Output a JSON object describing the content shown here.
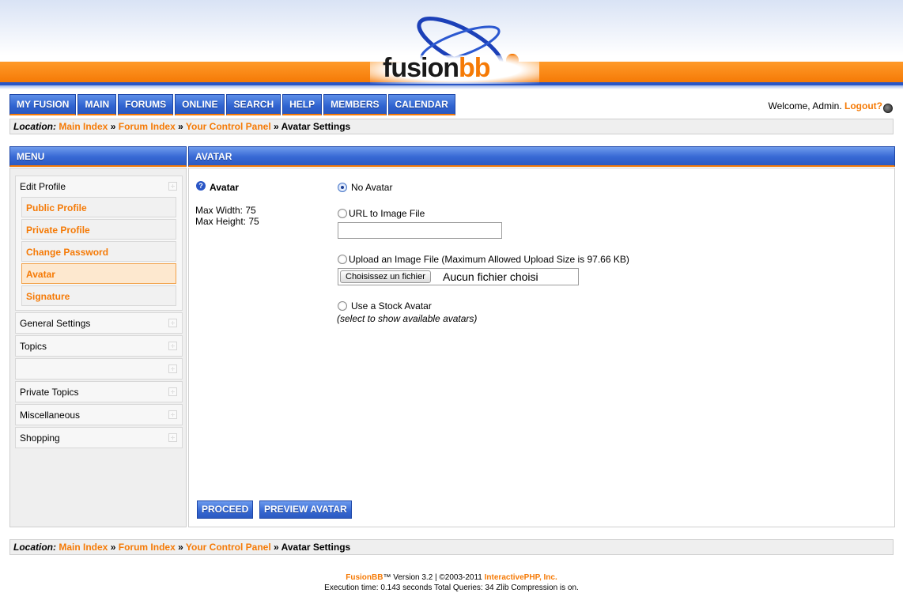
{
  "header": {
    "logo_fusion": "fusion",
    "logo_bb": "bb"
  },
  "nav": {
    "items": [
      {
        "label": "MY FUSION"
      },
      {
        "label": "MAIN"
      },
      {
        "label": "FORUMS"
      },
      {
        "label": "ONLINE"
      },
      {
        "label": "SEARCH"
      },
      {
        "label": "HELP"
      },
      {
        "label": "MEMBERS"
      },
      {
        "label": "CALENDAR"
      }
    ],
    "welcome_text": "Welcome, Admin.",
    "logout_label": "Logout?"
  },
  "location": {
    "label": "Location:",
    "crumbs": [
      "Main Index",
      "Forum Index",
      "Your Control Panel"
    ],
    "separator": "»",
    "current": "Avatar Settings"
  },
  "sidebar": {
    "title": "MENU",
    "edit_profile": {
      "title": "Edit Profile",
      "items": [
        "Public Profile",
        "Private Profile",
        "Change Password",
        "Avatar",
        "Signature"
      ],
      "active": "Avatar"
    },
    "groups": [
      "General Settings",
      "Topics",
      "",
      "Private Topics",
      "Miscellaneous",
      "Shopping"
    ]
  },
  "main": {
    "title": "AVATAR",
    "field_label": "Avatar",
    "max_width": "Max Width: 75",
    "max_height": "Max Height: 75",
    "options": {
      "no_avatar": "No Avatar",
      "url": "URL to Image File",
      "upload": "Upload an Image File (Maximum Allowed Upload Size is 97.66 KB)",
      "stock": "Use a Stock Avatar"
    },
    "selected_option": "no_avatar",
    "url_value": "",
    "file_button": "Choisissez un fichier",
    "file_status": "Aucun fichier choisi",
    "stock_hint": "(select to show available avatars)",
    "proceed_label": "PROCEED",
    "preview_label": "PREVIEW AVATAR"
  },
  "footer": {
    "brand": "FusionBB",
    "version_text": "™ Version 3.2 | ©2003-2011 ",
    "company": "InteractivePHP, Inc.",
    "stats": "Execution time: 0.143 seconds    Total Queries: 34    Zlib Compression is on."
  },
  "colors": {
    "accent_orange": "#f57a06",
    "nav_blue": "#2f63d0"
  }
}
